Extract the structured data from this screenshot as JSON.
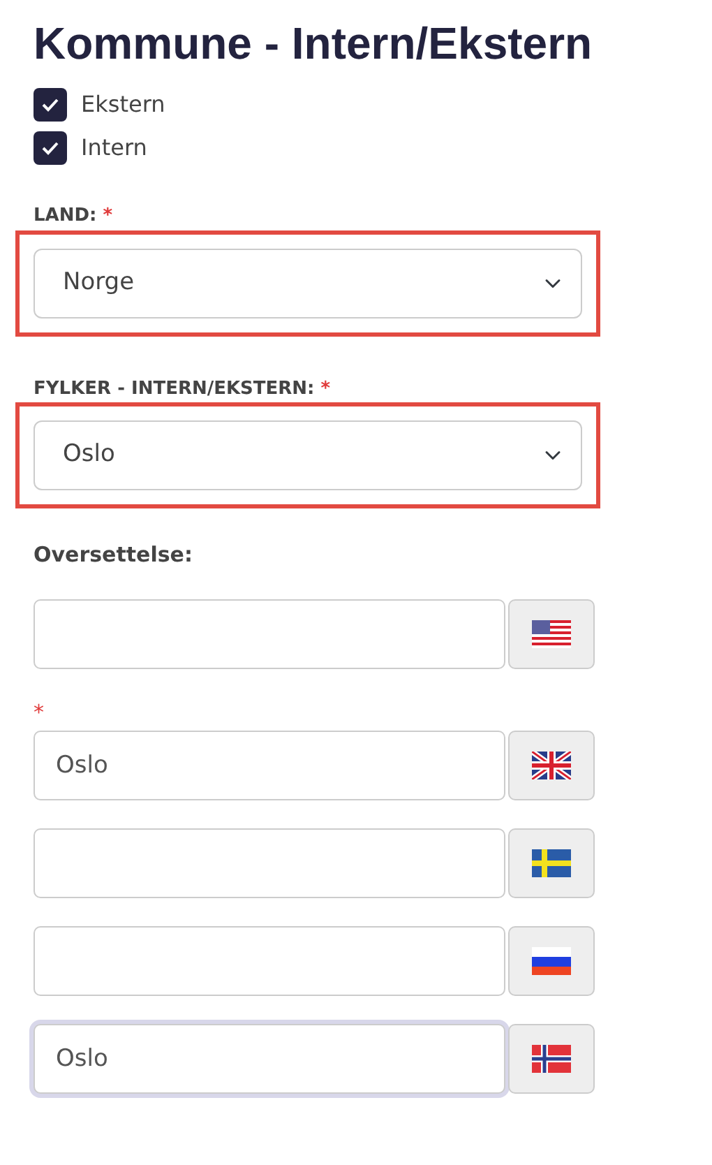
{
  "title": "Kommune - Intern/Ekstern",
  "checkboxes": [
    {
      "label": "Ekstern",
      "checked": true
    },
    {
      "label": "Intern",
      "checked": true
    }
  ],
  "selects": [
    {
      "label": "LAND:",
      "required_mark": "*",
      "value": "Norge",
      "highlighted": true
    },
    {
      "label": "FYLKER - INTERN/EKSTERN:",
      "required_mark": "*",
      "value": "Oslo",
      "highlighted": true
    }
  ],
  "translation": {
    "label": "Oversettelse:",
    "rows": [
      {
        "kind": "us",
        "value": "",
        "focused": false
      },
      {
        "kind": "gb",
        "value": "Oslo",
        "required_mark": "*",
        "focused": false
      },
      {
        "kind": "se",
        "value": "",
        "focused": false
      },
      {
        "kind": "ru",
        "value": "",
        "focused": false
      },
      {
        "kind": "no",
        "value": "Oslo",
        "focused": true
      }
    ]
  }
}
